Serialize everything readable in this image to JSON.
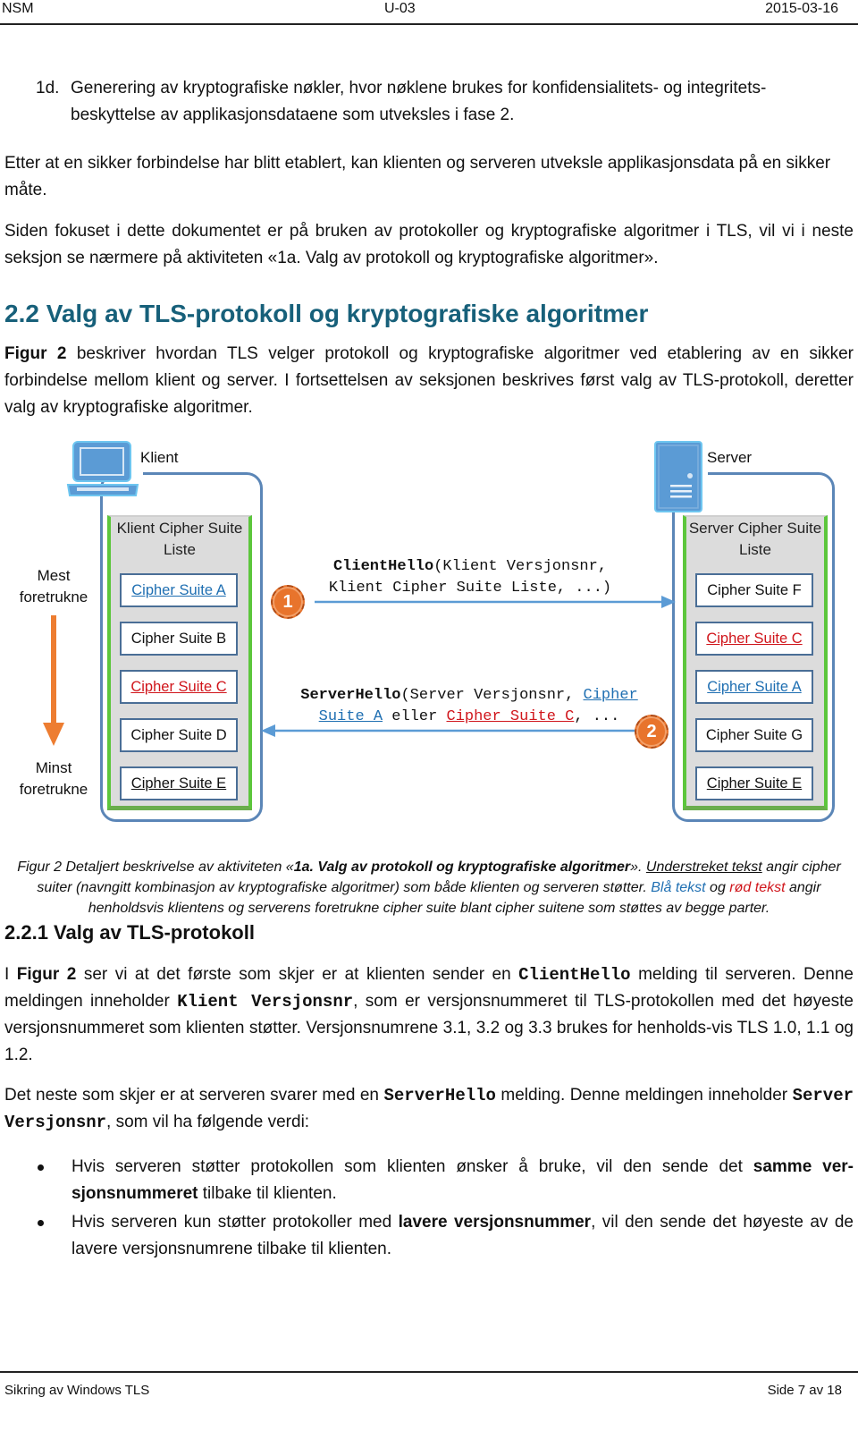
{
  "header": {
    "left": "NSM",
    "center": "U-03",
    "right": "2015-03-16"
  },
  "list_item_1d": {
    "marker": "1d.",
    "text": "Generering av kryptografiske nøkler, hvor nøklene brukes for konfidensialitets- og integritets-beskyttelse av applikasjonsdataene som utveksles i fase 2."
  },
  "para1": "Etter at en sikker forbindelse har blitt etablert, kan klienten og serveren utveksle applikasjonsdata på en sikker måte.",
  "para2": "Siden fokuset i dette dokumentet er på bruken av protokoller og kryptografiske algoritmer i TLS, vil vi i neste seksjon se nærmere på aktiviteten «1a. Valg av protokoll og kryptografiske algoritmer».",
  "section_heading": "2.2 Valg av TLS-protokoll og kryptografiske algoritmer",
  "para3": {
    "bold": "Figur 2",
    "text": " beskriver hvordan TLS velger protokoll og kryptografiske algoritmer ved etablering av en sikker forbindelse mellom klient og server. I fortsettelsen av seksjonen beskrives først valg av TLS-protokoll, deretter valg av kryptografiske algoritmer."
  },
  "diagram": {
    "client_label": "Klient",
    "server_label": "Server",
    "client_icon": "laptop-icon",
    "server_icon": "server-tower-icon",
    "most_preferred": "Mest foretrukne",
    "least_preferred": "Minst foretrukne",
    "client_list_title": "Klient Cipher Suite Liste",
    "server_list_title": "Server Cipher Suite Liste",
    "client_suites": [
      {
        "name": "Cipher Suite A",
        "style": "blue-underline"
      },
      {
        "name": "Cipher Suite B",
        "style": "plain"
      },
      {
        "name": "Cipher Suite C",
        "style": "red-underline"
      },
      {
        "name": "Cipher Suite D",
        "style": "plain"
      },
      {
        "name": "Cipher Suite E",
        "style": "underline"
      }
    ],
    "server_suites": [
      {
        "name": "Cipher Suite F",
        "style": "plain"
      },
      {
        "name": "Cipher Suite C",
        "style": "red-underline"
      },
      {
        "name": "Cipher Suite A",
        "style": "blue-underline"
      },
      {
        "name": "Cipher Suite G",
        "style": "plain"
      },
      {
        "name": "Cipher Suite E",
        "style": "underline"
      }
    ],
    "step1": {
      "badge": "1",
      "msg_bold": "ClientHello",
      "msg_rest": "(Klient Versjonsnr,",
      "msg_line2": "Klient Cipher Suite Liste, ...)"
    },
    "step2": {
      "badge": "2",
      "msg_bold": "ServerHello",
      "msg_rest": "(Server Versjonsnr, ",
      "msg_blue_1": "Cipher",
      "msg_blue_2": "Suite A",
      "msg_mid": " eller ",
      "msg_red": "Cipher Suite C",
      "msg_end": ", ..."
    },
    "colors": {
      "frame": "#5b86b7",
      "list_border": "#5cc63c",
      "arrow": "#5b9bd5",
      "pref_arrow": "#ed7d31",
      "badge": "#e8742c",
      "blue_text": "#1f6fb2",
      "red_text": "#d0151b"
    }
  },
  "caption": {
    "p1": "Figur 2 Detaljert beskrivelse av aktiviteten «",
    "bold": "1a. Valg av protokoll og kryptografiske algoritmer",
    "p2": "». ",
    "underlined": "Understreket tekst",
    "p3": " angir cipher suiter (navngitt kombinasjon av kryptografiske algoritmer) som både klienten og serveren støtter. ",
    "blue": "Blå tekst",
    "p4": " og ",
    "red": "rød tekst",
    "p5": " angir henholdsvis klientens og serverens foretrukne cipher suite blant cipher suitene som støttes av begge parter."
  },
  "subsection_heading": "2.2.1 Valg av TLS-protokoll",
  "para4": {
    "t1": "I ",
    "b1": "Figur 2",
    "t2": " ser vi at det første som skjer er at klienten sender en ",
    "m1": "ClientHello",
    "t3": " melding til serveren. Denne meldingen inneholder ",
    "m2": "Klient Versjonsnr",
    "t4": ", som er versjonsnummeret til TLS-protokollen med det høyeste versjonsnummeret som klienten støtter. Versjonsnumrene 3.1, 3.2 og 3.3 brukes for henholds-vis TLS 1.0, 1.1 og 1.2."
  },
  "para5": {
    "t1": "Det neste som skjer er at serveren svarer med en ",
    "m1": "ServerHello",
    "t2": " melding. Denne meldingen inneholder ",
    "m2": "Server Versjonsnr",
    "t3": ", som vil ha følgende verdi:"
  },
  "bullets": [
    {
      "t1": "Hvis serveren støtter protokollen som klienten ønsker å bruke, vil den sende det ",
      "b": "samme ver-sjonsnummeret",
      "t2": " tilbake til klienten."
    },
    {
      "t1": "Hvis serveren kun støtter protokoller med ",
      "b": "lavere versjonsnummer",
      "t2": ", vil den sende det høyeste av de lavere versjonsnumrene tilbake til klienten."
    }
  ],
  "footer": {
    "left": "Sikring av Windows TLS",
    "right": "Side 7 av 18"
  }
}
